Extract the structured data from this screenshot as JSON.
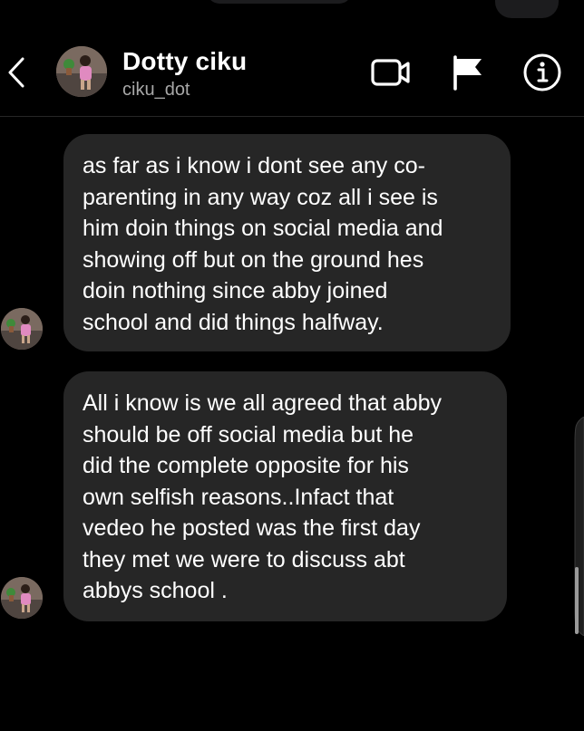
{
  "header": {
    "name": "Dotty ciku",
    "username": "ciku_dot",
    "icons": [
      "chevron-left-icon",
      "video-call-icon",
      "flag-icon",
      "info-icon"
    ]
  },
  "messages": [
    {
      "sender": "Dotty ciku",
      "text": "as far as i know i dont see any co-\nparenting in any way coz all i see is\nhim doin things on social media and\nshowing off but on the ground hes\ndoin nothing since abby joined\nschool and did things halfway."
    },
    {
      "sender": "Dotty ciku",
      "text": "All i know is we all agreed that abby\nshould be off social media but he\ndid the complete opposite for his\nown selfish reasons..Infact that\nvedeo he posted was the first day\nthey met we were to discuss abt\nabbys  school ."
    }
  ],
  "colors": {
    "background": "#000000",
    "bubble": "#262626",
    "text": "#ffffff",
    "secondary_text": "#a8a8a8"
  }
}
